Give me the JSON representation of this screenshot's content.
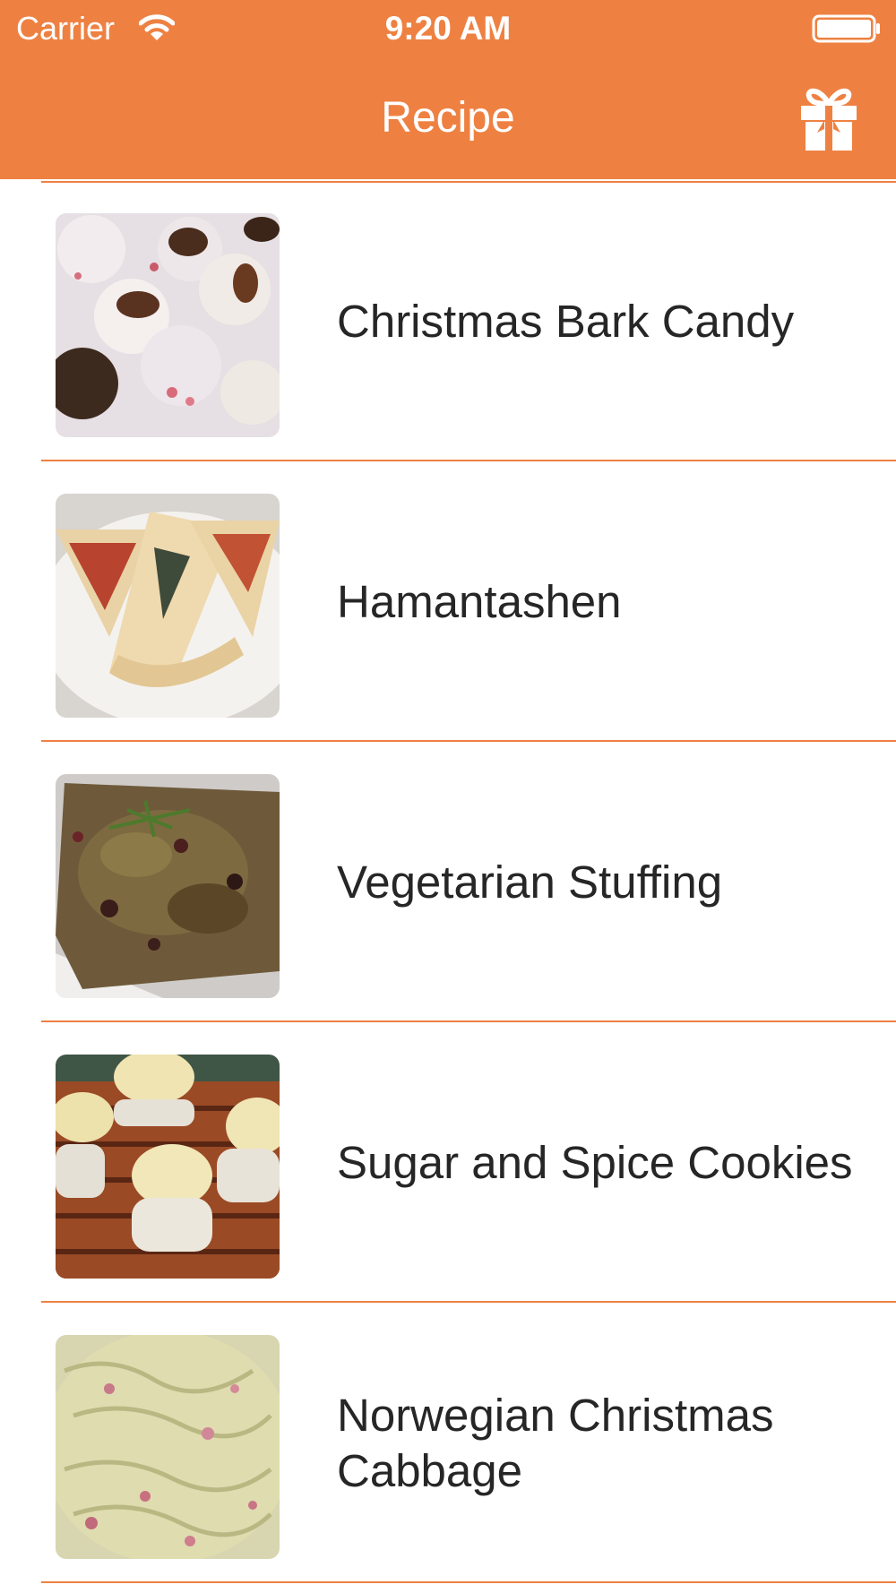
{
  "status_bar": {
    "carrier": "Carrier",
    "time": "9:20 AM",
    "wifi_icon": "wifi-icon",
    "battery_icon": "battery-icon"
  },
  "nav": {
    "title": "Recipe",
    "gift_icon": "gift-icon"
  },
  "colors": {
    "accent": "#ee8142",
    "text": "#262626",
    "background": "#ffffff"
  },
  "recipes": [
    {
      "title": "Christmas Bark Candy"
    },
    {
      "title": "Hamantashen"
    },
    {
      "title": "Vegetarian Stuffing"
    },
    {
      "title": "Sugar and Spice Cookies"
    },
    {
      "title": "Norwegian Christmas Cabbage"
    }
  ]
}
